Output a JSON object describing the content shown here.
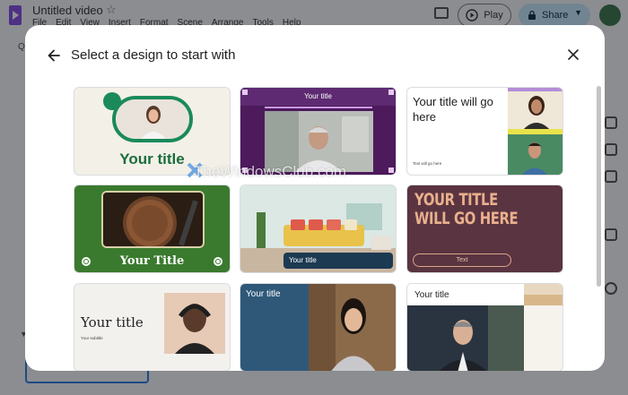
{
  "app": {
    "doc_title": "Untitled video",
    "menu": [
      "File",
      "Edit",
      "View",
      "Insert",
      "Format",
      "Scene",
      "Arrange",
      "Tools",
      "Help"
    ],
    "play_label": "Play",
    "share_label": "Share",
    "left_fragment": "Q"
  },
  "dialog": {
    "title": "Select a design to start with"
  },
  "templates": [
    {
      "title": "Your title"
    },
    {
      "title": "Your title"
    },
    {
      "title": "Your title will go here",
      "subtitle": "Text will go here"
    },
    {
      "title": "Your Title"
    },
    {
      "title": "Your title"
    },
    {
      "title": "YOUR TITLE WILL GO HERE",
      "button": "Text"
    },
    {
      "title": "Your title",
      "subtitle": "Your subtitle"
    },
    {
      "title": "Your title"
    },
    {
      "title": "Your title"
    }
  ],
  "watermark": "TheWindowsClub.com",
  "colors": {
    "accent_purple": "#7b3fe4",
    "share_blue": "#c2e7ff",
    "focus_blue": "#1a73e8"
  }
}
